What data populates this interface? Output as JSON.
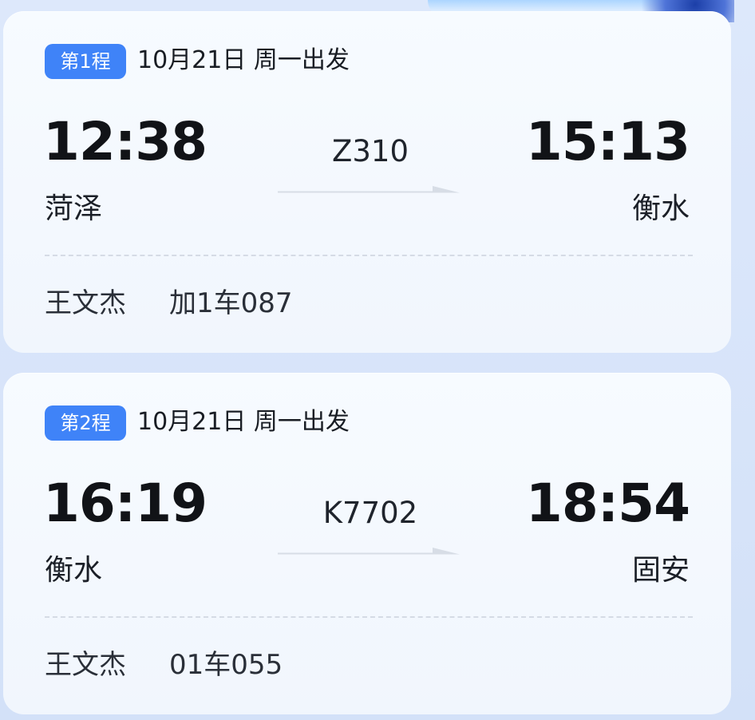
{
  "trips": [
    {
      "badge": "第1程",
      "date": "10月21日 周一出发",
      "depart_time": "12:38",
      "arrive_time": "15:13",
      "train_no": "Z310",
      "from_station": "菏泽",
      "to_station": "衡水",
      "passenger": "王文杰",
      "seat": "加1车087"
    },
    {
      "badge": "第2程",
      "date": "10月21日 周一出发",
      "depart_time": "16:19",
      "arrive_time": "18:54",
      "train_no": "K7702",
      "from_station": "衡水",
      "to_station": "固安",
      "passenger": "王文杰",
      "seat": "01车055"
    }
  ],
  "colors": {
    "accent": "#3f83f8",
    "card_background": "#f7fbff",
    "page_background": "#dde8fb",
    "arrow": "#d7dde6"
  },
  "icons": {
    "direction_arrow": "arrow-right-icon"
  }
}
